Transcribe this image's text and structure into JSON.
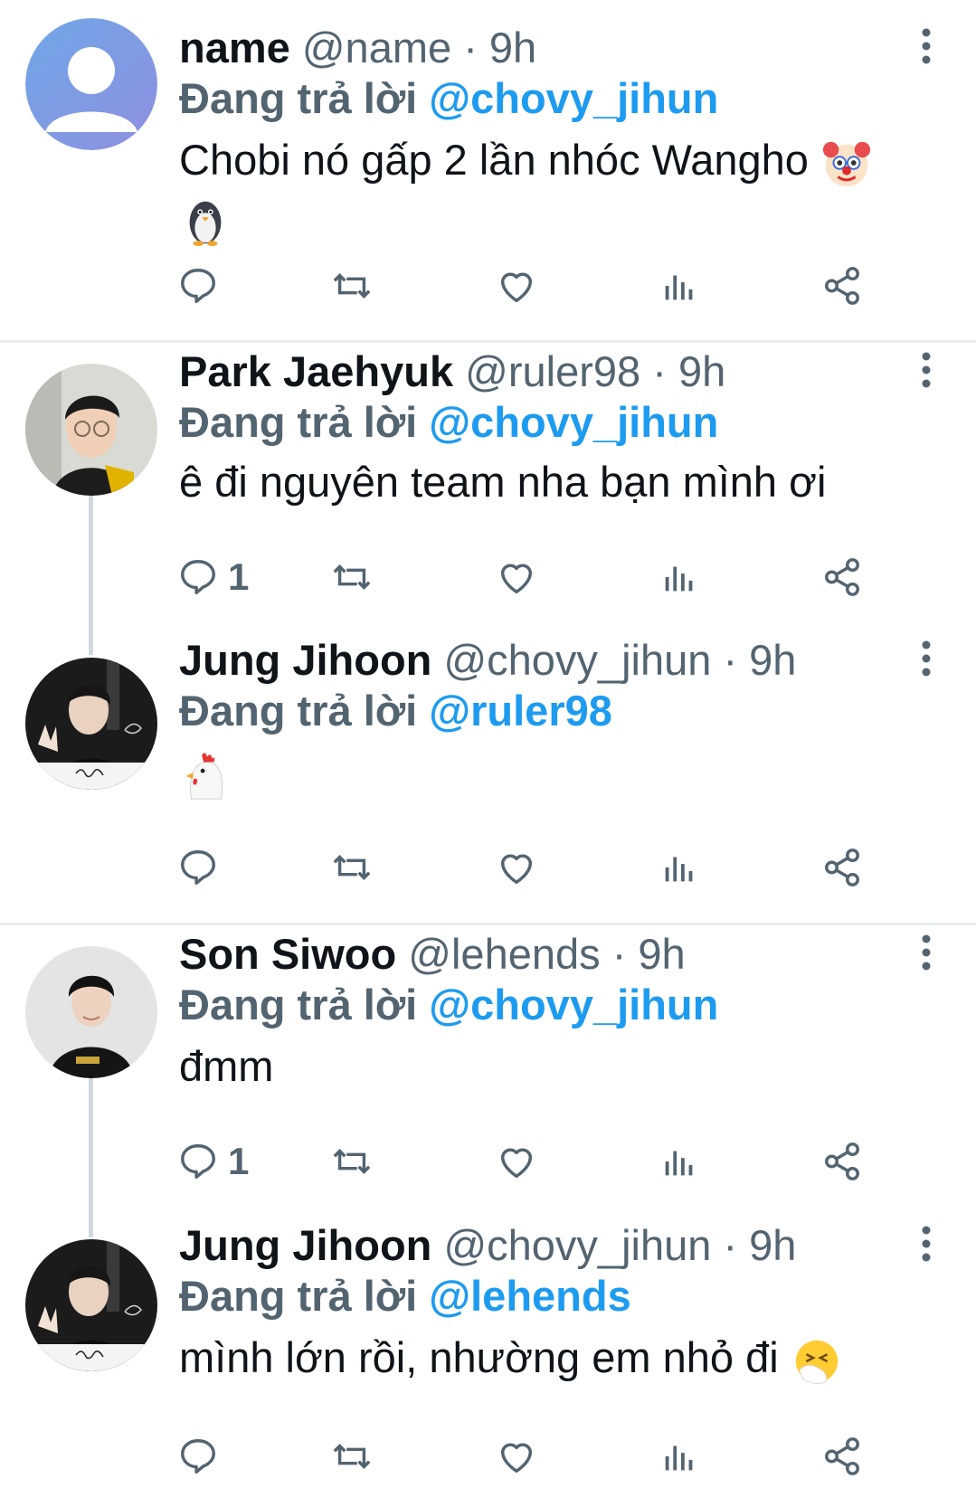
{
  "tweets": [
    {
      "name": "name",
      "handle": "@name",
      "time": "· 9h",
      "reply_prefix": "Đang trả lời ",
      "reply_to": "@chovy_jihun",
      "text": "Chobi nó gấp 2 lần nhóc Wangho",
      "emojis": [
        "clown-emoji",
        "penguin-emoji"
      ],
      "reply_count": "",
      "avatar": "default-avatar"
    },
    {
      "name": "Park Jaehyuk",
      "handle": "@ruler98",
      "time": "· 9h",
      "reply_prefix": "Đang trả lời ",
      "reply_to": "@chovy_jihun",
      "text": "ê đi nguyên team nha bạn mình ơi",
      "emojis": [],
      "reply_count": "1",
      "avatar": "profile-photo"
    },
    {
      "name": "Jung Jihoon",
      "handle": "@chovy_jihun",
      "time": "· 9h",
      "reply_prefix": "Đang trả lời ",
      "reply_to": "@ruler98",
      "text": "",
      "emojis": [
        "chicken-emoji"
      ],
      "reply_count": "",
      "avatar": "profile-photo"
    },
    {
      "name": "Son Siwoo",
      "handle": "@lehends",
      "time": "· 9h",
      "reply_prefix": "Đang trả lời ",
      "reply_to": "@chovy_jihun",
      "text": "đmm",
      "emojis": [],
      "reply_count": "1",
      "avatar": "profile-photo"
    },
    {
      "name": "Jung Jihoon",
      "handle": "@chovy_jihun",
      "time": "· 9h",
      "reply_prefix": "Đang trả lời ",
      "reply_to": "@lehends",
      "text": "mình lớn rồi, nhường em nhỏ đi",
      "emojis": [
        "sneezing-face-emoji"
      ],
      "reply_count": "",
      "avatar": "profile-photo"
    }
  ],
  "action_icons": [
    "reply-icon",
    "retweet-icon",
    "like-icon",
    "analytics-icon",
    "share-icon"
  ],
  "colors": {
    "link": "#1d9bf0",
    "secondary_text": "#536471",
    "primary_text": "#0f1419",
    "divider": "#e6ecf0",
    "thread_line": "#cfd9de"
  }
}
